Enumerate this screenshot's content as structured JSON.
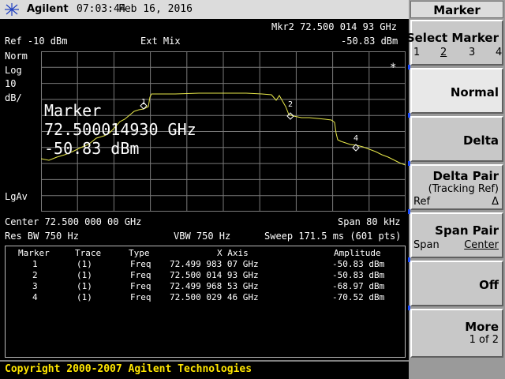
{
  "titlebar": {
    "brand": "Agilent",
    "time": "07:03:44",
    "date": "Feb 16, 2016"
  },
  "display": {
    "mkr_readout": "Mkr2  72.500 014 93 GHz",
    "ref_level": "Ref -10 dBm",
    "mixer": "Ext Mix",
    "mkr_amplitude": "-50.83 dBm",
    "scale_mode": "Norm",
    "scale_type": "Log",
    "scale_div": "10",
    "scale_unit": "dB/",
    "averaging": "LgAv",
    "asterisk": "*",
    "marker_label": "Marker",
    "marker_freq": "72.500014930 GHz",
    "marker_amp": "-50.83 dBm",
    "center": "Center 72.500 000 00 GHz",
    "span": "Span 80 kHz",
    "res_bw": "Res BW 750 Hz",
    "vbw": "VBW 750 Hz",
    "sweep": "Sweep 171.5 ms (601 pts)",
    "trace_color": "#e8e84a",
    "marker_labels": [
      "1",
      "2",
      "4"
    ]
  },
  "marker_table": {
    "headers": [
      "Marker",
      "Trace",
      "Type",
      "X Axis",
      "Amplitude"
    ],
    "rows": [
      {
        "marker": "1",
        "trace": "(1)",
        "type": "Freq",
        "x": "72.499 983 07 GHz",
        "amp": "-50.83 dBm"
      },
      {
        "marker": "2",
        "trace": "(1)",
        "type": "Freq",
        "x": "72.500 014 93 GHz",
        "amp": "-50.83 dBm"
      },
      {
        "marker": "3",
        "trace": "(1)",
        "type": "Freq",
        "x": "72.499 968 53 GHz",
        "amp": "-68.97 dBm"
      },
      {
        "marker": "4",
        "trace": "(1)",
        "type": "Freq",
        "x": "72.500 029 46 GHz",
        "amp": "-70.52 dBm"
      }
    ]
  },
  "copyright": "Copyright 2000-2007 Agilent Technologies",
  "softkeys": {
    "menu_title": "Marker",
    "select_marker": {
      "label": "Select Marker",
      "options": [
        "1",
        "2",
        "3",
        "4"
      ],
      "selected": "2"
    },
    "normal": "Normal",
    "delta": "Delta",
    "delta_pair": {
      "label": "Delta Pair",
      "sub": "(Tracking Ref)",
      "left": "Ref",
      "right": "Δ"
    },
    "span_pair": {
      "label": "Span Pair",
      "left": "Span",
      "right": "Center"
    },
    "off": "Off",
    "more": {
      "label": "More",
      "page": "1 of 2"
    }
  }
}
